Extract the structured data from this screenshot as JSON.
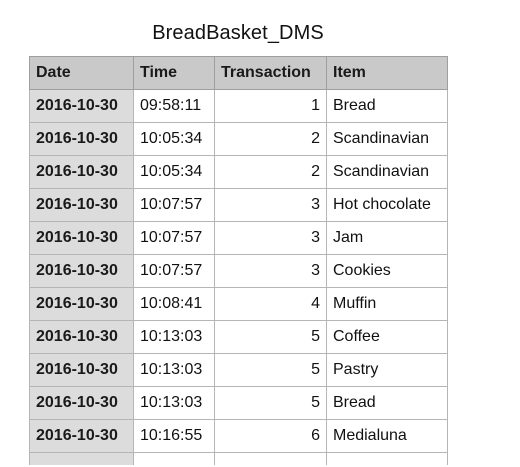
{
  "sheet": {
    "title": "BreadBasket_DMS"
  },
  "table": {
    "columns": [
      "Date",
      "Time",
      "Transaction",
      "Item"
    ],
    "rows": [
      [
        "2016-10-30",
        "09:58:11",
        "1",
        "Bread"
      ],
      [
        "2016-10-30",
        "10:05:34",
        "2",
        "Scandinavian"
      ],
      [
        "2016-10-30",
        "10:05:34",
        "2",
        "Scandinavian"
      ],
      [
        "2016-10-30",
        "10:07:57",
        "3",
        "Hot chocolate"
      ],
      [
        "2016-10-30",
        "10:07:57",
        "3",
        "Jam"
      ],
      [
        "2016-10-30",
        "10:07:57",
        "3",
        "Cookies"
      ],
      [
        "2016-10-30",
        "10:08:41",
        "4",
        "Muffin"
      ],
      [
        "2016-10-30",
        "10:13:03",
        "5",
        "Coffee"
      ],
      [
        "2016-10-30",
        "10:13:03",
        "5",
        "Pastry"
      ],
      [
        "2016-10-30",
        "10:13:03",
        "5",
        "Bread"
      ],
      [
        "2016-10-30",
        "10:16:55",
        "6",
        "Medialuna"
      ]
    ]
  },
  "colors": {
    "header_bg": "#c9c9c9",
    "date_column_bg": "#dcdcdc",
    "grid_line": "#b5b5b5"
  }
}
